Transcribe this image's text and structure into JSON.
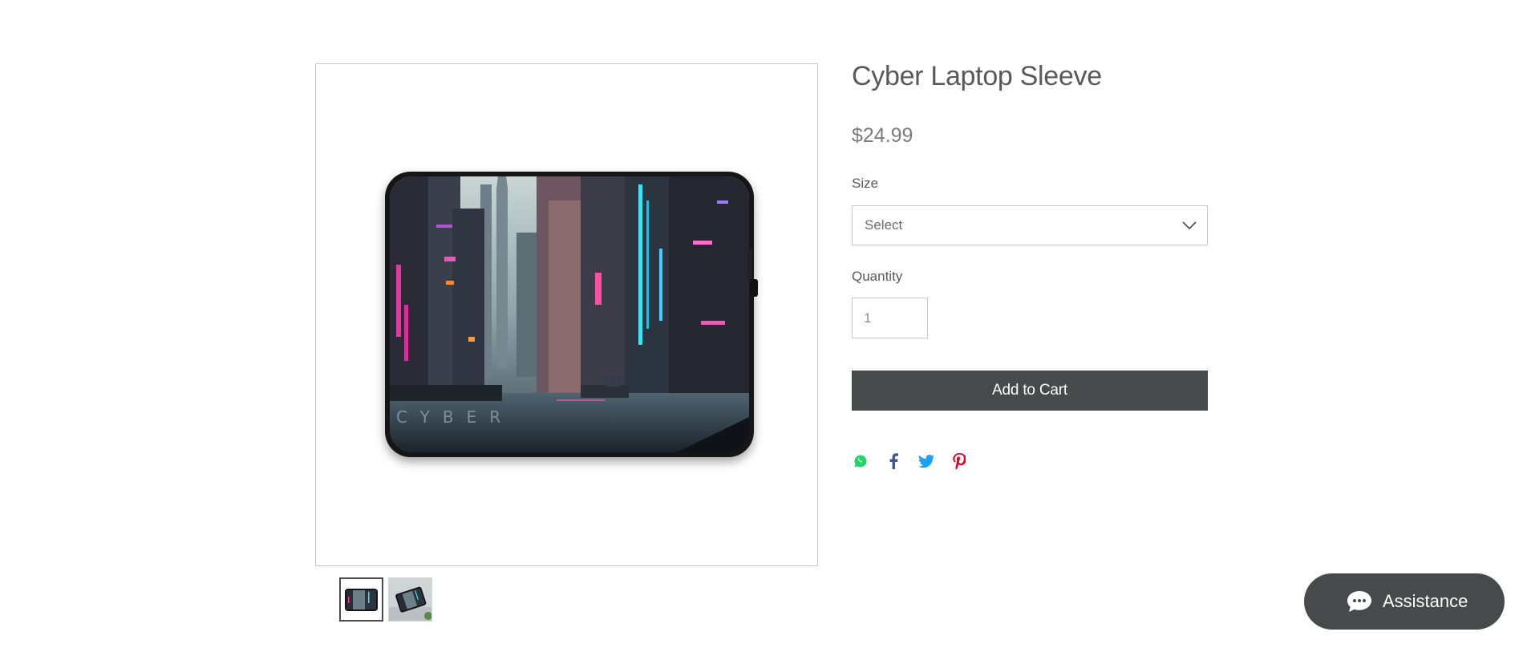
{
  "product": {
    "title": "Cyber Laptop Sleeve",
    "price": "$24.99",
    "image_text": "CYBER",
    "thumbnails": [
      {
        "name": "laptop-sleeve-front",
        "active": true
      },
      {
        "name": "laptop-sleeve-lifestyle",
        "active": false
      }
    ]
  },
  "options": {
    "size_label": "Size",
    "size_value": "Select",
    "quantity_label": "Quantity",
    "quantity_value": "1"
  },
  "cart": {
    "add_label": "Add to Cart",
    "button_color": "#48494b"
  },
  "share": {
    "icons": [
      "whatsapp-icon",
      "facebook-icon",
      "twitter-icon",
      "pinterest-icon"
    ],
    "colors": {
      "whatsapp": "#25d366",
      "facebook": "#3b5998",
      "twitter": "#1da1f2",
      "pinterest": "#e60023"
    }
  },
  "chat": {
    "label": "Assistance",
    "icon": "chat-bubble-icon"
  }
}
